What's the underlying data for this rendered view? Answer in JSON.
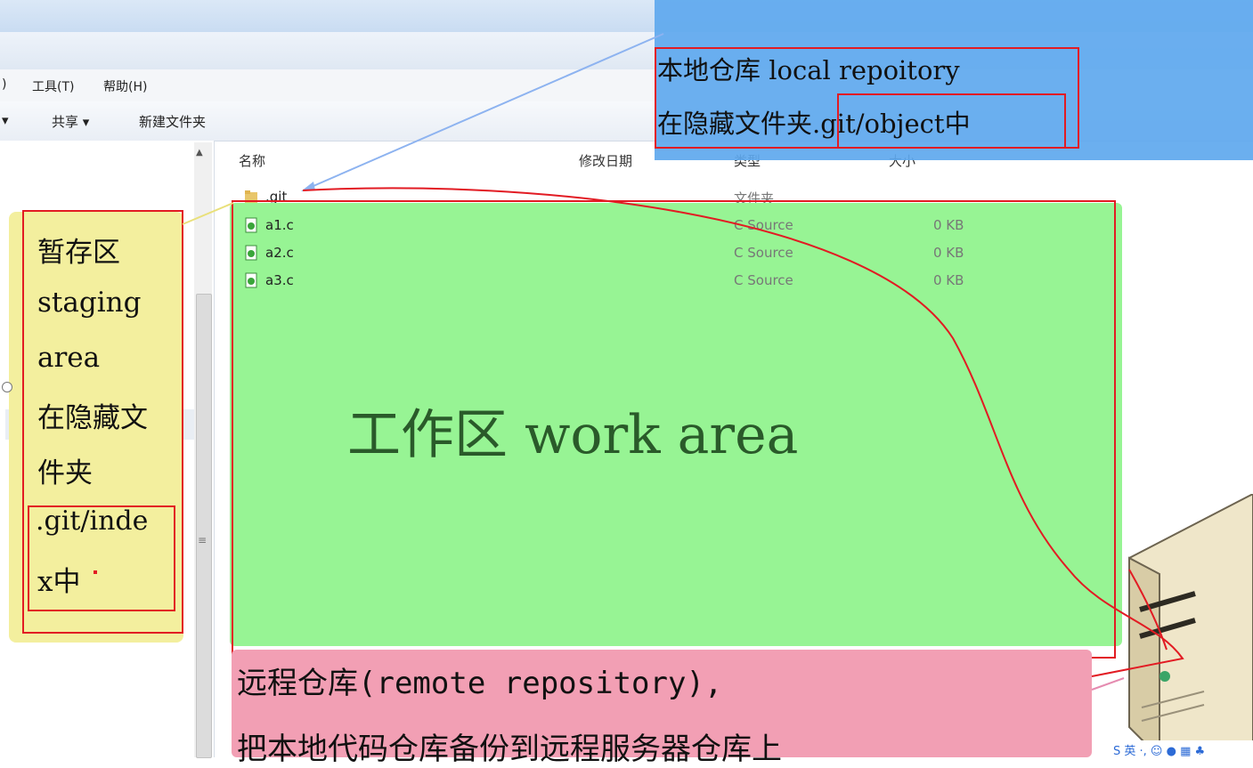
{
  "menubar": {
    "fragment": ")",
    "tools": "工具(T)",
    "help": "帮助(H)"
  },
  "toolbar": {
    "arrow": "▾",
    "share": "共享 ▾",
    "new_folder": "新建文件夹"
  },
  "columns": {
    "name": "名称",
    "date": "修改日期",
    "type": "类型",
    "size": "大小"
  },
  "files": [
    {
      "name": ".git",
      "type": "文件夹",
      "size": ""
    },
    {
      "name": "a1.c",
      "type": "C Source",
      "size": "0 KB"
    },
    {
      "name": "a2.c",
      "type": "C Source",
      "size": "0 KB"
    },
    {
      "name": "a3.c",
      "type": "C Source",
      "size": "0 KB"
    }
  ],
  "local_repo": {
    "line1": "本地仓库 local repoitory",
    "line2_a": "在隐藏文件夹",
    "line2_b": ".git/object中"
  },
  "staging": {
    "l1": "暂存区",
    "l2": "staging",
    "l3": "area",
    "l4": "在隐藏文",
    "l5": "件夹",
    "l6": ".git/inde",
    "l7": "x中"
  },
  "work_area": "工作区 work area",
  "remote": {
    "l1": "远程仓库(remote repository),",
    "l2": "把本地代码仓库备份到远程服务器仓库上"
  },
  "ime": {
    "label": "S 英 ·, ☺ ● ▦ ♣"
  },
  "colors": {
    "blue": "#5ea8ee",
    "yellow": "#f3ef9e",
    "green": "#97f494",
    "pink": "#f29fb4",
    "red": "#e21b23"
  }
}
